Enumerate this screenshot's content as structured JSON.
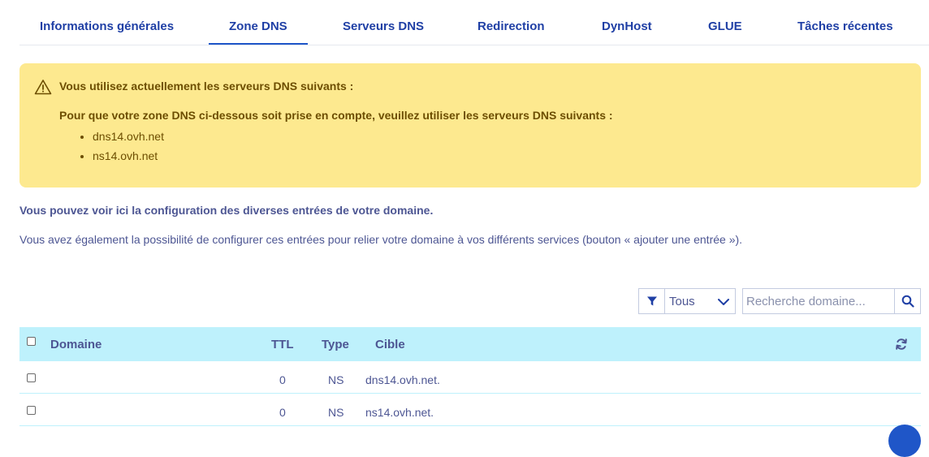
{
  "tabs": [
    {
      "label": "Informations générales"
    },
    {
      "label": "Zone DNS"
    },
    {
      "label": "Serveurs DNS"
    },
    {
      "label": "Redirection"
    },
    {
      "label": "DynHost"
    },
    {
      "label": "GLUE"
    },
    {
      "label": "Tâches récentes"
    }
  ],
  "active_tab": "Zone DNS",
  "alert": {
    "icon": "warning-icon",
    "title": "Vous utilisez actuellement les serveurs DNS suivants :",
    "body": "Pour que votre zone DNS ci-dessous soit prise en compte, veuillez utiliser les serveurs DNS suivants :",
    "servers": [
      "dns14.ovh.net",
      "ns14.ovh.net"
    ],
    "background": "#fde98f",
    "text_color": "#6d4e00"
  },
  "intro": {
    "bold": "Vous pouvez voir ici la configuration des diverses entrées de votre domaine.",
    "text": "Vous avez également la possibilité de configurer ces entrées pour relier votre domaine à vos différents services (bouton « ajouter une entrée »)."
  },
  "filter": {
    "icon": "filter-icon",
    "selected": "Tous"
  },
  "search": {
    "placeholder": "Recherche domaine...",
    "value": "",
    "icon": "search-icon"
  },
  "table": {
    "columns": {
      "domain": "Domaine",
      "ttl": "TTL",
      "type": "Type",
      "target": "Cible"
    },
    "refresh_icon": "refresh-icon",
    "rows": [
      {
        "domain": "",
        "ttl": "0",
        "type": "NS",
        "target": "dns14.ovh.net."
      },
      {
        "domain": "",
        "ttl": "0",
        "type": "NS",
        "target": "ns14.ovh.net."
      }
    ],
    "header_background": "#bef1fc"
  },
  "colors": {
    "accent": "#1f56c8",
    "tab_text": "#1f3fa5",
    "body_text": "#4d5693"
  }
}
